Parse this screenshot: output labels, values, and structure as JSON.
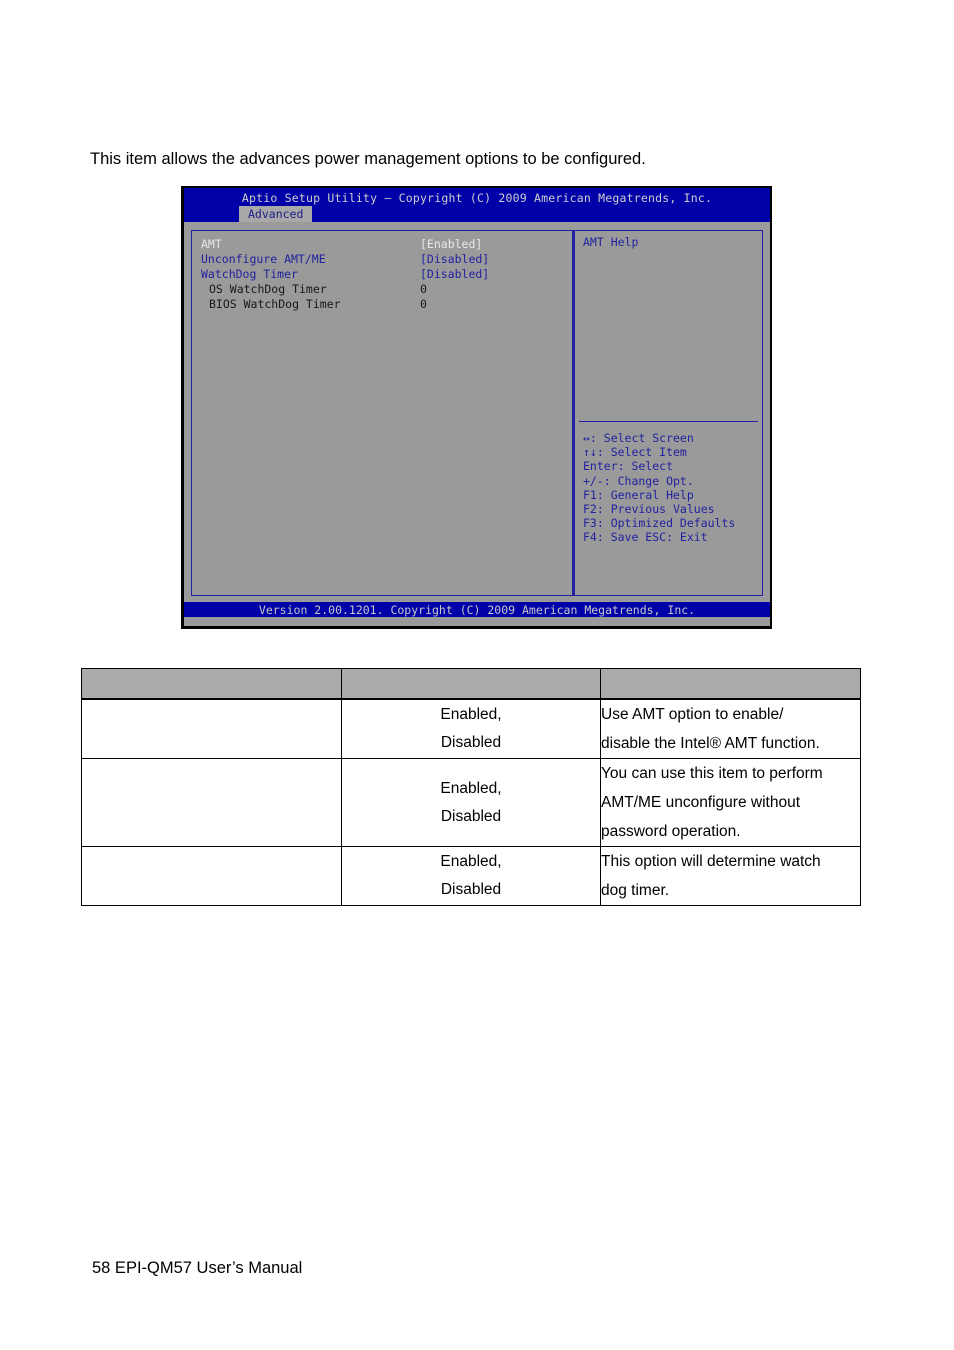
{
  "intro": {
    "text": "This item allows the advances power management options to be configured."
  },
  "bios": {
    "title": "Aptio Setup Utility – Copyright (C) 2009 American Megatrends, Inc.",
    "tab": "Advanced",
    "options": [
      {
        "label": "AMT",
        "value": "[Enabled]",
        "label_color": "white",
        "value_color": "white",
        "indent": false
      },
      {
        "label": "Unconfigure AMT/ME",
        "value": "[Disabled]",
        "label_color": "blue",
        "value_color": "blue",
        "indent": false
      },
      {
        "label": "WatchDog Timer",
        "value": "[Disabled]",
        "label_color": "blue",
        "value_color": "blue",
        "indent": false
      },
      {
        "label": "OS WatchDog Timer",
        "value": "0",
        "label_color": "dark",
        "value_color": "dark",
        "indent": true
      },
      {
        "label": "BIOS WatchDog Timer",
        "value": "0",
        "label_color": "dark",
        "value_color": "dark",
        "indent": true
      }
    ],
    "help_title": "AMT Help",
    "navkeys": [
      "↔: Select Screen",
      "↑↓: Select Item",
      "Enter: Select",
      "+/-: Change Opt.",
      "F1: General Help",
      "F2: Previous Values",
      "F3: Optimized Defaults",
      "F4: Save  ESC: Exit"
    ],
    "footer": "Version 2.00.1201. Copyright (C) 2009 American Megatrends, Inc.",
    "colors": {
      "title_bar": "#0000a8",
      "panel_bg": "#9a9a9a",
      "panel_border": "#2222a0",
      "tab_bg": "#a8a8a8"
    }
  },
  "spec_table": {
    "headers": [
      "",
      "",
      ""
    ],
    "rows": [
      {
        "item": "",
        "options": "Enabled,\nDisabled",
        "description": "Use AMT option to enable/\ndisable the Intel® AMT function."
      },
      {
        "item": "",
        "options": "Enabled,\nDisabled",
        "description": "You can use this item to perform\nAMT/ME unconfigure without\npassword operation."
      },
      {
        "item": "",
        "options": "Enabled,\nDisabled",
        "description": "This option will determine watch\ndog timer."
      }
    ]
  },
  "page_footer": {
    "text": "58 EPI-QM57 User’s Manual"
  }
}
